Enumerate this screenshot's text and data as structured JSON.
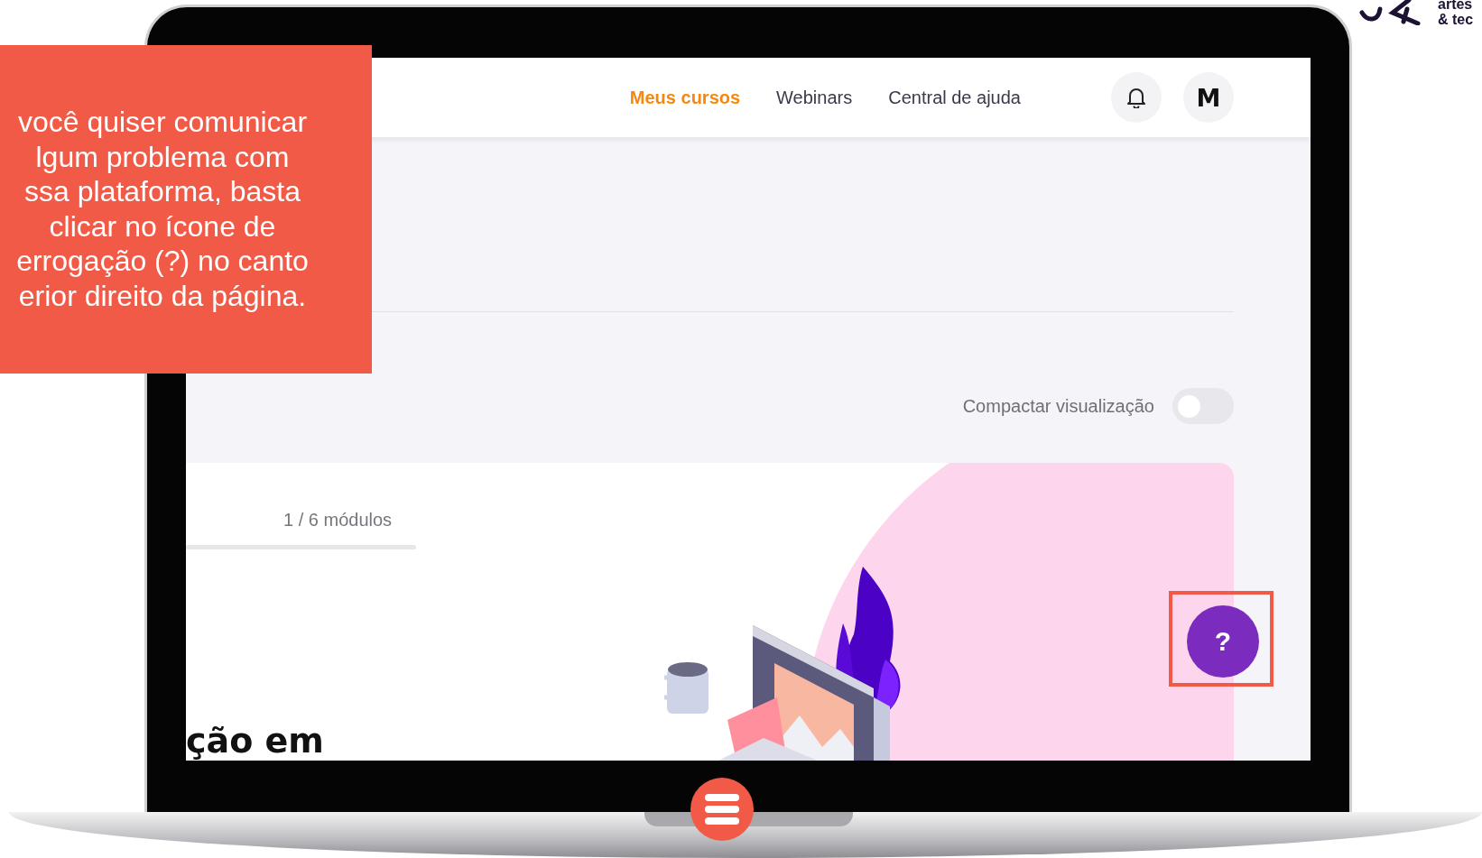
{
  "callout": {
    "lines": [
      "você quiser comunicar",
      "lgum problema com",
      "ssa plataforma, basta",
      "clicar no ícone de",
      "errogação (?) no canto",
      "erior direito da página."
    ]
  },
  "logo": {
    "lines": [
      "artes",
      "& tec"
    ]
  },
  "header": {
    "nav": [
      {
        "label": "Meus cursos",
        "selected": true
      },
      {
        "label": "Webinars",
        "selected": false
      },
      {
        "label": "Central de ajuda",
        "selected": false
      }
    ],
    "avatar": "M"
  },
  "view_toggle": {
    "label": "Compactar visualização",
    "on": false
  },
  "course": {
    "progress": "1 / 6 módulos",
    "title": "ção em"
  },
  "help_button": {
    "label": "?"
  }
}
